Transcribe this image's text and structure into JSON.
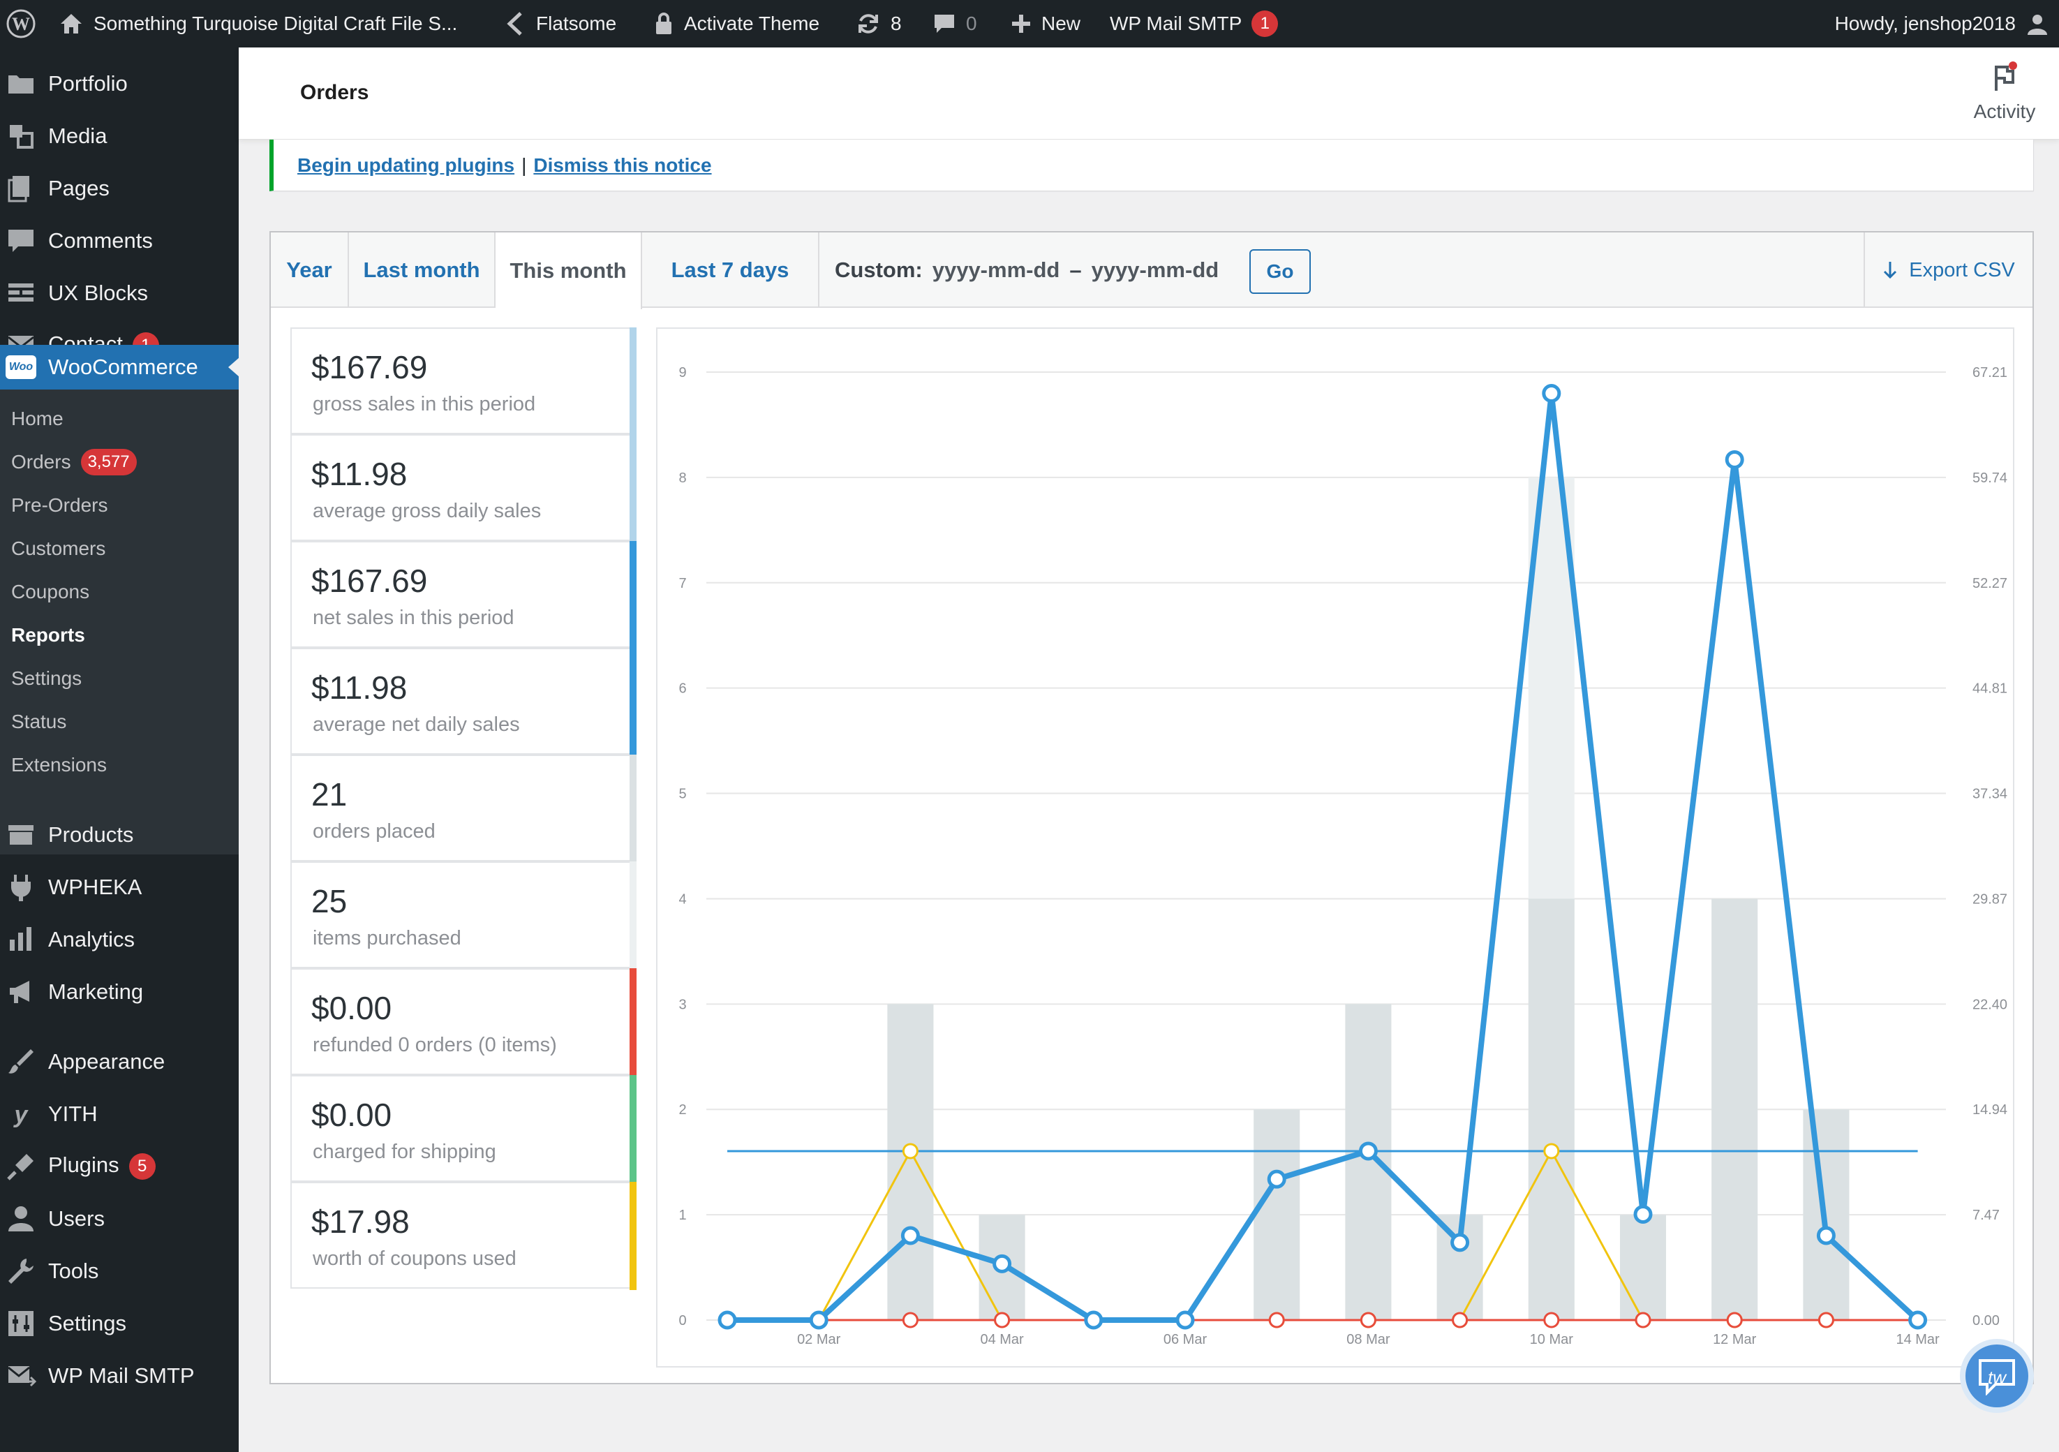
{
  "adminbar": {
    "site_name": "Something Turquoise Digital Craft File S...",
    "theme": "Flatsome",
    "activate": "Activate Theme",
    "updates": "8",
    "comments": "0",
    "new": "New",
    "smtp": "WP Mail SMTP",
    "smtp_badge": "1",
    "howdy": "Howdy, jenshop2018"
  },
  "sidebar": {
    "top_items": [
      {
        "label": "Portfolio",
        "icon": "folder-icon"
      },
      {
        "label": "Media",
        "icon": "media-icon"
      },
      {
        "label": "Pages",
        "icon": "pages-icon"
      },
      {
        "label": "Comments",
        "icon": "comment-icon"
      },
      {
        "label": "UX Blocks",
        "icon": "blocks-icon"
      },
      {
        "label": "Contact",
        "icon": "mail-icon",
        "badge": "1"
      }
    ],
    "woocommerce": "WooCommerce",
    "woo_logo": "Woo",
    "sub_items": [
      {
        "label": "Home"
      },
      {
        "label": "Orders",
        "badge": "3,577"
      },
      {
        "label": "Pre-Orders"
      },
      {
        "label": "Customers"
      },
      {
        "label": "Coupons"
      },
      {
        "label": "Reports",
        "current": true
      },
      {
        "label": "Settings"
      },
      {
        "label": "Status"
      },
      {
        "label": "Extensions"
      }
    ],
    "bottom_items": [
      {
        "label": "Products",
        "icon": "products-icon"
      },
      {
        "label": "WPHEKA",
        "icon": "plugin-icon"
      },
      {
        "label": "Analytics",
        "icon": "analytics-icon"
      },
      {
        "label": "Marketing",
        "icon": "megaphone-icon"
      },
      {
        "label": "Appearance",
        "icon": "brush-icon"
      },
      {
        "label": "YITH",
        "icon": "yith-icon"
      },
      {
        "label": "Plugins",
        "icon": "plug-icon",
        "badge": "5"
      },
      {
        "label": "Users",
        "icon": "user-icon"
      },
      {
        "label": "Tools",
        "icon": "wrench-icon"
      },
      {
        "label": "Settings",
        "icon": "settings-icon"
      },
      {
        "label": "WP Mail SMTP",
        "icon": "mail-smtp-icon"
      }
    ]
  },
  "header": {
    "title": "Orders",
    "activity": "Activity"
  },
  "notice": {
    "link1": "Begin updating plugins",
    "separator": "|",
    "link2": "Dismiss this notice"
  },
  "tabs": {
    "items": [
      "Year",
      "Last month",
      "This month",
      "Last 7 days"
    ],
    "active": "This month",
    "custom_label": "Custom:",
    "start_placeholder": "yyyy-mm-dd",
    "dash": "–",
    "end_placeholder": "yyyy-mm-dd",
    "go": "Go",
    "export": "Export CSV"
  },
  "legend": [
    {
      "amount": "$167.69",
      "desc": "gross sales in this period",
      "color": "#b1d4ea"
    },
    {
      "amount": "$11.98",
      "desc": "average gross daily sales",
      "color": "#b1d4ea"
    },
    {
      "amount": "$167.69",
      "desc": "net sales in this period",
      "color": "#3498db"
    },
    {
      "amount": "$11.98",
      "desc": "average net daily sales",
      "color": "#3498db"
    },
    {
      "amount": "21",
      "desc": "orders placed",
      "color": "#dbe1e3"
    },
    {
      "amount": "25",
      "desc": "items purchased",
      "color": "#ecf0f1"
    },
    {
      "amount": "$0.00",
      "desc": "refunded 0 orders (0 items)",
      "color": "#e74c3c"
    },
    {
      "amount": "$0.00",
      "desc": "charged for shipping",
      "color": "#5cc488"
    },
    {
      "amount": "$17.98",
      "desc": "worth of coupons used",
      "color": "#f1c40f"
    }
  ],
  "chart_data": {
    "type": "bar",
    "x_tick_labels": [
      "02 Mar",
      "04 Mar",
      "06 Mar",
      "08 Mar",
      "10 Mar",
      "12 Mar",
      "14 Mar"
    ],
    "days": [
      "01 Mar",
      "02 Mar",
      "03 Mar",
      "04 Mar",
      "05 Mar",
      "06 Mar",
      "07 Mar",
      "08 Mar",
      "09 Mar",
      "10 Mar",
      "11 Mar",
      "12 Mar",
      "13 Mar",
      "14 Mar"
    ],
    "y_left_ticks": [
      "0",
      "1",
      "2",
      "3",
      "4",
      "5",
      "6",
      "7",
      "8",
      "9"
    ],
    "y_left_lim": [
      0,
      9
    ],
    "y_right_ticks": [
      "0.00",
      "7.47",
      "14.94",
      "22.40",
      "29.87",
      "37.34",
      "44.81",
      "52.27",
      "59.74",
      "67.21"
    ],
    "y_right_lim": [
      0,
      67.21
    ],
    "grid": true,
    "series": [
      {
        "kind": "bar",
        "color": "#ecf0f1",
        "axis": "left",
        "values": [
          0,
          0,
          3,
          1,
          0,
          0,
          2,
          3,
          1,
          8,
          1,
          4,
          2,
          0
        ]
      },
      {
        "kind": "bar",
        "color": "#dbe1e3",
        "axis": "left",
        "values": [
          0,
          0,
          3,
          1,
          0,
          0,
          2,
          3,
          1,
          4,
          1,
          4,
          2,
          0
        ]
      },
      {
        "kind": "line",
        "color": "#3498db",
        "axis": "right",
        "markers": true,
        "values": [
          0,
          0,
          5.99,
          3.99,
          0,
          0,
          9.99,
          11.98,
          5.5,
          65.7,
          7.5,
          61.0,
          5.99,
          0
        ]
      },
      {
        "kind": "line",
        "color": "#f1c40f",
        "axis": "right",
        "markers": true,
        "values": [
          0,
          0,
          11.98,
          0,
          0,
          0,
          0,
          0,
          0,
          11.98,
          0,
          0,
          0,
          0
        ]
      },
      {
        "kind": "line",
        "color": "#e74c3c",
        "axis": "right",
        "markers": true,
        "values": [
          0,
          0,
          0,
          0,
          0,
          0,
          0,
          0,
          0,
          0,
          0,
          0,
          0,
          0
        ]
      },
      {
        "kind": "average",
        "color": "#3498db",
        "axis": "right",
        "value": 11.98
      }
    ]
  },
  "chat": {
    "label": "tw"
  }
}
